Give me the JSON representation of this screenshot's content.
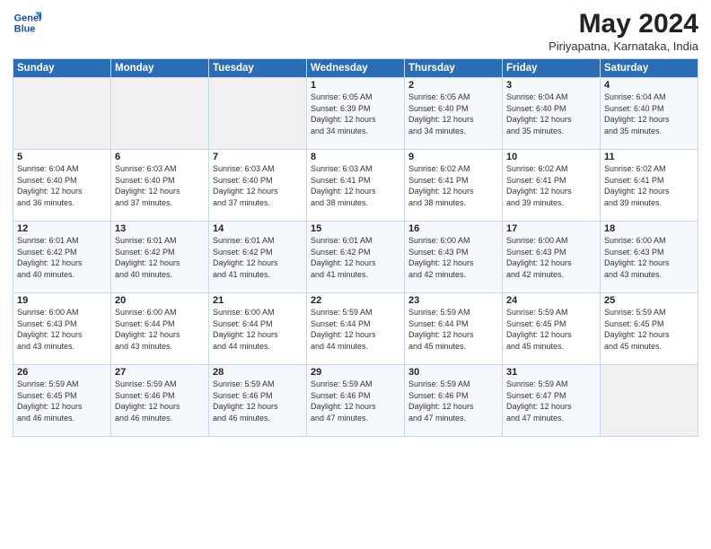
{
  "header": {
    "logo_line1": "General",
    "logo_line2": "Blue",
    "month_title": "May 2024",
    "location": "Piriyapatna, Karnataka, India"
  },
  "days_of_week": [
    "Sunday",
    "Monday",
    "Tuesday",
    "Wednesday",
    "Thursday",
    "Friday",
    "Saturday"
  ],
  "weeks": [
    [
      {
        "day": "",
        "info": ""
      },
      {
        "day": "",
        "info": ""
      },
      {
        "day": "",
        "info": ""
      },
      {
        "day": "1",
        "info": "Sunrise: 6:05 AM\nSunset: 6:39 PM\nDaylight: 12 hours\nand 34 minutes."
      },
      {
        "day": "2",
        "info": "Sunrise: 6:05 AM\nSunset: 6:40 PM\nDaylight: 12 hours\nand 34 minutes."
      },
      {
        "day": "3",
        "info": "Sunrise: 6:04 AM\nSunset: 6:40 PM\nDaylight: 12 hours\nand 35 minutes."
      },
      {
        "day": "4",
        "info": "Sunrise: 6:04 AM\nSunset: 6:40 PM\nDaylight: 12 hours\nand 35 minutes."
      }
    ],
    [
      {
        "day": "5",
        "info": "Sunrise: 6:04 AM\nSunset: 6:40 PM\nDaylight: 12 hours\nand 36 minutes."
      },
      {
        "day": "6",
        "info": "Sunrise: 6:03 AM\nSunset: 6:40 PM\nDaylight: 12 hours\nand 37 minutes."
      },
      {
        "day": "7",
        "info": "Sunrise: 6:03 AM\nSunset: 6:40 PM\nDaylight: 12 hours\nand 37 minutes."
      },
      {
        "day": "8",
        "info": "Sunrise: 6:03 AM\nSunset: 6:41 PM\nDaylight: 12 hours\nand 38 minutes."
      },
      {
        "day": "9",
        "info": "Sunrise: 6:02 AM\nSunset: 6:41 PM\nDaylight: 12 hours\nand 38 minutes."
      },
      {
        "day": "10",
        "info": "Sunrise: 6:02 AM\nSunset: 6:41 PM\nDaylight: 12 hours\nand 39 minutes."
      },
      {
        "day": "11",
        "info": "Sunrise: 6:02 AM\nSunset: 6:41 PM\nDaylight: 12 hours\nand 39 minutes."
      }
    ],
    [
      {
        "day": "12",
        "info": "Sunrise: 6:01 AM\nSunset: 6:42 PM\nDaylight: 12 hours\nand 40 minutes."
      },
      {
        "day": "13",
        "info": "Sunrise: 6:01 AM\nSunset: 6:42 PM\nDaylight: 12 hours\nand 40 minutes."
      },
      {
        "day": "14",
        "info": "Sunrise: 6:01 AM\nSunset: 6:42 PM\nDaylight: 12 hours\nand 41 minutes."
      },
      {
        "day": "15",
        "info": "Sunrise: 6:01 AM\nSunset: 6:42 PM\nDaylight: 12 hours\nand 41 minutes."
      },
      {
        "day": "16",
        "info": "Sunrise: 6:00 AM\nSunset: 6:43 PM\nDaylight: 12 hours\nand 42 minutes."
      },
      {
        "day": "17",
        "info": "Sunrise: 6:00 AM\nSunset: 6:43 PM\nDaylight: 12 hours\nand 42 minutes."
      },
      {
        "day": "18",
        "info": "Sunrise: 6:00 AM\nSunset: 6:43 PM\nDaylight: 12 hours\nand 43 minutes."
      }
    ],
    [
      {
        "day": "19",
        "info": "Sunrise: 6:00 AM\nSunset: 6:43 PM\nDaylight: 12 hours\nand 43 minutes."
      },
      {
        "day": "20",
        "info": "Sunrise: 6:00 AM\nSunset: 6:44 PM\nDaylight: 12 hours\nand 43 minutes."
      },
      {
        "day": "21",
        "info": "Sunrise: 6:00 AM\nSunset: 6:44 PM\nDaylight: 12 hours\nand 44 minutes."
      },
      {
        "day": "22",
        "info": "Sunrise: 5:59 AM\nSunset: 6:44 PM\nDaylight: 12 hours\nand 44 minutes."
      },
      {
        "day": "23",
        "info": "Sunrise: 5:59 AM\nSunset: 6:44 PM\nDaylight: 12 hours\nand 45 minutes."
      },
      {
        "day": "24",
        "info": "Sunrise: 5:59 AM\nSunset: 6:45 PM\nDaylight: 12 hours\nand 45 minutes."
      },
      {
        "day": "25",
        "info": "Sunrise: 5:59 AM\nSunset: 6:45 PM\nDaylight: 12 hours\nand 45 minutes."
      }
    ],
    [
      {
        "day": "26",
        "info": "Sunrise: 5:59 AM\nSunset: 6:45 PM\nDaylight: 12 hours\nand 46 minutes."
      },
      {
        "day": "27",
        "info": "Sunrise: 5:59 AM\nSunset: 6:46 PM\nDaylight: 12 hours\nand 46 minutes."
      },
      {
        "day": "28",
        "info": "Sunrise: 5:59 AM\nSunset: 6:46 PM\nDaylight: 12 hours\nand 46 minutes."
      },
      {
        "day": "29",
        "info": "Sunrise: 5:59 AM\nSunset: 6:46 PM\nDaylight: 12 hours\nand 47 minutes."
      },
      {
        "day": "30",
        "info": "Sunrise: 5:59 AM\nSunset: 6:46 PM\nDaylight: 12 hours\nand 47 minutes."
      },
      {
        "day": "31",
        "info": "Sunrise: 5:59 AM\nSunset: 6:47 PM\nDaylight: 12 hours\nand 47 minutes."
      },
      {
        "day": "",
        "info": ""
      }
    ]
  ]
}
